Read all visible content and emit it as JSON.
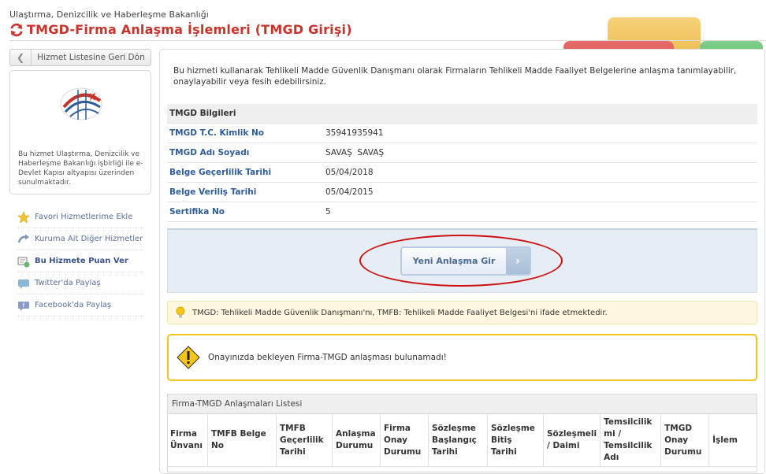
{
  "header": {
    "ministry": "Ulaştırma, Denizcilik ve Haberleşme Bakanlığı",
    "title": "TMGD-Firma Anlaşma İşlemleri (TMGD Girişi)"
  },
  "sidebar": {
    "back_label": "Hizmet Listesine Geri Dön",
    "description": "Bu hizmet Ulaştırma, Denizcilik ve Haberleşme Bakanlığı işbirliği ile e-Devlet Kapısı altyapısı üzerinden sunulmaktadır.",
    "links": [
      {
        "label": "Favori Hizmetlerime Ekle",
        "icon": "star-icon"
      },
      {
        "label": "Kuruma Ait Diğer Hizmetler",
        "icon": "share-arrow-icon"
      },
      {
        "label": "Bu Hizmete Puan Ver",
        "icon": "rating-icon"
      },
      {
        "label": "Twitter'da Paylaş",
        "icon": "twitter-icon"
      },
      {
        "label": "Facebook'da Paylaş",
        "icon": "facebook-icon"
      }
    ]
  },
  "main": {
    "intro": "Bu hizmeti kullanarak Tehlikeli Madde Güvenlik Danışmanı olarak Firmaların Tehlikeli Madde Faaliyet Belgelerine anlaşma tanımlayabilir, onaylayabilir veya fesih edebilirsiniz.",
    "info_header": "TMGD Bilgileri",
    "info_rows": [
      {
        "label": "TMGD T.C. Kimlik No",
        "value": "35941935941"
      },
      {
        "label": "TMGD Adı Soyadı",
        "value": "SAVAŞ  SAVAŞ"
      },
      {
        "label": "Belge Geçerlilik Tarihi",
        "value": "05/04/2018"
      },
      {
        "label": "Belge Veriliş Tarihi",
        "value": "05/04/2015"
      },
      {
        "label": "Sertifika No",
        "value": "5"
      }
    ],
    "new_button": "Yeni Anlaşma Gir",
    "tip": "TMGD: Tehlikeli Madde Güvenlik Danışmanı'nı, TMFB: Tehlikeli Madde Faaliyet Belgesi'ni ifade etmektedir.",
    "warning": "Onayınızda bekleyen Firma-TMGD anlaşması bulunamadı!",
    "list_title": "Firma-TMGD Anlaşmaları Listesi",
    "columns": [
      "Firma Ünvanı",
      "TMFB Belge No",
      "TMFB Geçerlilik Tarihi",
      "Anlaşma Durumu",
      "Firma Onay Durumu",
      "Sözleşme Başlangıç Tarihi",
      "Sözleşme Bitiş Tarihi",
      "Sözleşmeli / Daimi",
      "Temsilcilik mi / Temsilcilik Adı",
      "TMGD Onay Durumu",
      "İşlem"
    ]
  },
  "colors": {
    "title_red": "#c8332b",
    "label_blue": "#2f5d95",
    "annotation_red": "#cc1111",
    "warning_yellow": "#f0c419"
  }
}
